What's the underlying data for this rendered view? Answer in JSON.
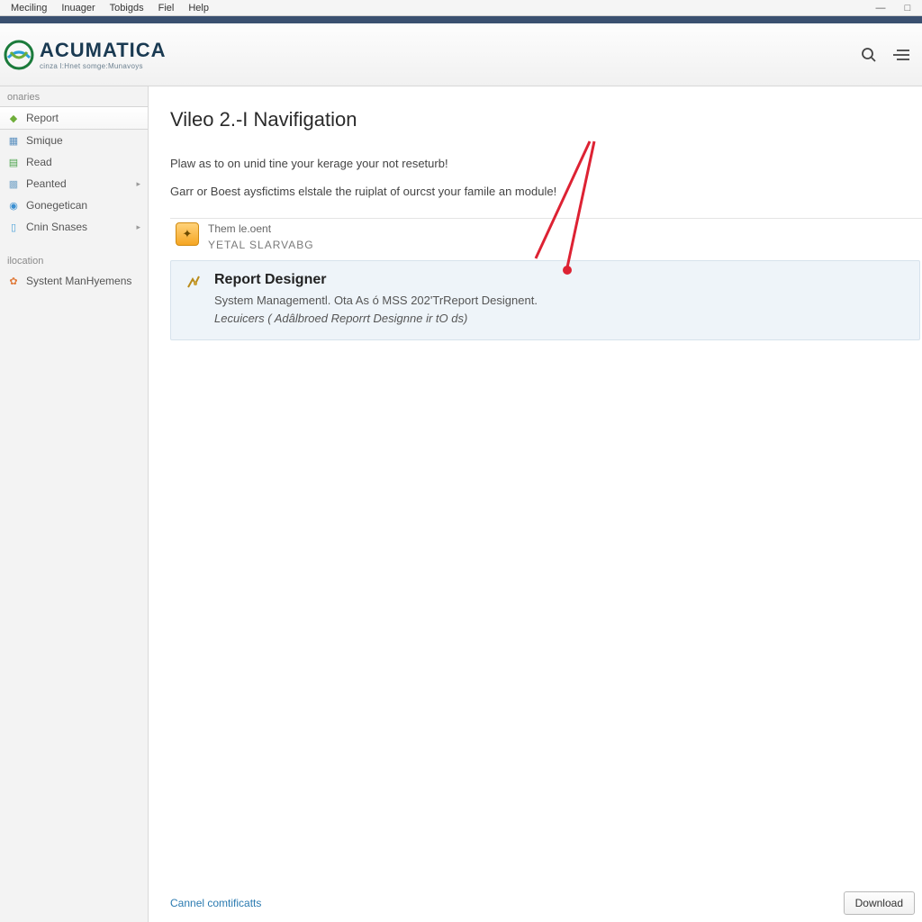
{
  "menubar": {
    "items": [
      "Meciling",
      "Inuager",
      "Tobigds",
      "Fiel",
      "Help"
    ]
  },
  "brand": {
    "title": "ACUMATICA",
    "subtitle": "cinza l:Hnet somge:Munavoys"
  },
  "sidebar": {
    "section1": "onaries",
    "items": [
      {
        "label": "Report",
        "active": true,
        "icon": "report-icon",
        "color": "#6fae3a"
      },
      {
        "label": "Smique",
        "icon": "module-icon",
        "color": "#5a8fbf"
      },
      {
        "label": "Read",
        "icon": "doc-icon",
        "color": "#4aa24a"
      },
      {
        "label": "Peanted",
        "icon": "grid-icon",
        "color": "#7aa7c9",
        "arrow": true
      },
      {
        "label": "Gonegetican",
        "icon": "cube-icon",
        "color": "#3b8fd1"
      },
      {
        "label": "Cnin Snases",
        "icon": "folder-icon",
        "color": "#4aa0d8",
        "arrow": true
      }
    ],
    "section2": "ilocation",
    "items2": [
      {
        "label": "Systent ManHyemens",
        "icon": "gear-icon",
        "color": "#e07a3a"
      }
    ]
  },
  "page": {
    "title": "Vileo 2.-I Navifigation",
    "intro1": "Plaw as to on unid tine your kerage your not reseturb!",
    "intro2": "Garr or Boest aysfictims elstale the ruiplat of ourcst your famile an module!",
    "card": {
      "line1": "Them le.oent",
      "line2": "YETAL SLARVABG"
    },
    "result": {
      "title": "Report Designer",
      "line1": "System Managementl. Ota As ó MSS 202'TrReport Designent.",
      "line2": "Lecuicers ( Adâlbroed Reporrt Designne ir tO ds)"
    }
  },
  "footer": {
    "link": "Cannel comtificatts",
    "button": "Download"
  }
}
